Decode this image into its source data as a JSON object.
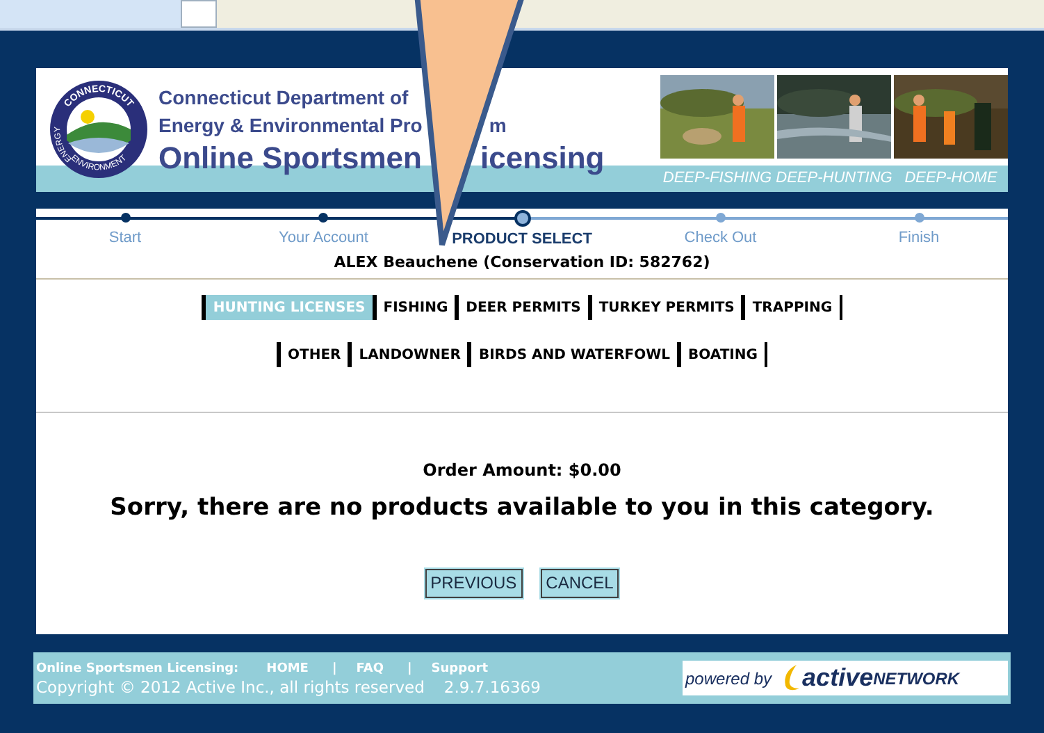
{
  "header": {
    "logo_text": [
      "CONNECTICUT",
      "ENERGY",
      "ENVIRONMENT"
    ],
    "department_line_1": "Connecticut Department of",
    "department_line_2": [
      "Energy & Environmental Pro",
      "m"
    ],
    "title": [
      "Online Sportsmen",
      "icensing"
    ],
    "photo_links": [
      {
        "label": "DEEP-FISHING"
      },
      {
        "label": "DEEP-HUNTING"
      },
      {
        "label": "DEEP-HOME"
      }
    ]
  },
  "progress": {
    "steps": [
      {
        "label": "Start",
        "selected": false,
        "completed": true
      },
      {
        "label": "Your Account",
        "selected": false,
        "completed": true
      },
      {
        "label": "PRODUCT SELECT",
        "selected": true,
        "completed": false
      },
      {
        "label": "Check Out",
        "selected": false,
        "completed": false
      },
      {
        "label": "Finish",
        "selected": false,
        "completed": false
      }
    ],
    "customer": "ALEX Beauchene (Conservation ID: 582762)"
  },
  "category_tabs": [
    [
      {
        "label": "HUNTING LICENSES",
        "selected": true
      },
      {
        "label": "FISHING",
        "selected": false
      },
      {
        "label": "DEER PERMITS",
        "selected": false
      },
      {
        "label": "TURKEY PERMITS",
        "selected": false
      },
      {
        "label": "TRAPPING",
        "selected": false
      }
    ],
    [
      {
        "label": "OTHER",
        "selected": false
      },
      {
        "label": "LANDOWNER",
        "selected": false
      },
      {
        "label": "BIRDS AND WATERFOWL",
        "selected": false
      },
      {
        "label": "BOATING",
        "selected": false
      }
    ]
  ],
  "order_amount": "Order Amount: $0.00",
  "message": "Sorry, there are no products available to you in this category.",
  "buttons": [
    "PREVIOUS",
    "CANCEL"
  ],
  "footer": {
    "site_label": "Online Sportsmen Licensing:",
    "links": [
      "HOME",
      "FAQ",
      "Support"
    ],
    "separator": "|",
    "copyright": "Copyright © 2012 Active Inc., all rights reserved",
    "version": "2.9.7.16369",
    "powered_by": "powered by",
    "brand": "active",
    "brand_suffix": "NETWORK"
  }
}
